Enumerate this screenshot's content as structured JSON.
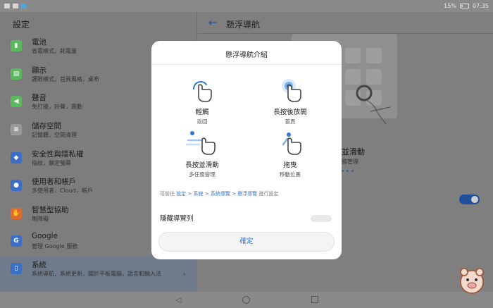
{
  "status": {
    "battery": "15%",
    "time": "07:35"
  },
  "left": {
    "title": "設定",
    "items": [
      {
        "title": "電池",
        "sub": "省電模式，耗電量",
        "icon": "battery-icon",
        "color": "#5bb85c"
      },
      {
        "title": "顯示",
        "sub": "護眼模式，首頁風格，桌布",
        "icon": "display-icon",
        "color": "#5bb85c"
      },
      {
        "title": "聲音",
        "sub": "免打擾，鈴聲，震動",
        "icon": "sound-icon",
        "color": "#5bb85c"
      },
      {
        "title": "儲存空間",
        "sub": "記憶體，空間清理",
        "icon": "storage-icon",
        "color": "#9a9a9a"
      },
      {
        "title": "安全性與隱私權",
        "sub": "指紋，鎖定螢幕",
        "icon": "shield-icon",
        "color": "#3b6fc6"
      },
      {
        "title": "使用者和帳戶",
        "sub": "多使用者，Cloud，帳戶",
        "icon": "account-icon",
        "color": "#3b6fc6"
      },
      {
        "title": "智慧型協助",
        "sub": "無障礙",
        "icon": "hand-icon",
        "color": "#e06a2c"
      },
      {
        "title": "Google",
        "sub": "管理 Google 服務",
        "icon": "google-icon",
        "color": "#3b6fc6"
      },
      {
        "title": "系統",
        "sub": "系統導航，系統更新，關於平板電腦，語言和輸入法",
        "icon": "system-icon",
        "color": "#3b6fc6"
      }
    ]
  },
  "right": {
    "title": "懸浮導航",
    "peek_title": "並滑動",
    "peek_sub": "務管理"
  },
  "dialog": {
    "title": "懸浮導航介紹",
    "gestures": [
      {
        "label": "輕觸",
        "sub": "返回"
      },
      {
        "label": "長按後放開",
        "sub": "首頁"
      },
      {
        "label": "長按並滑動",
        "sub": "多任務管理"
      },
      {
        "label": "拖曳",
        "sub": "移動位置"
      }
    ],
    "hint_prefix": "可前往 ",
    "hint_link": "設定 > 系統 > 系統導覽 > 懸浮導覽",
    "hint_suffix": " 進行設定",
    "hide_label": "隱藏導覽列",
    "ok_label": "確定"
  },
  "colors": {
    "accent": "#2e78d1",
    "dim_bg": "#7f7f7f"
  }
}
